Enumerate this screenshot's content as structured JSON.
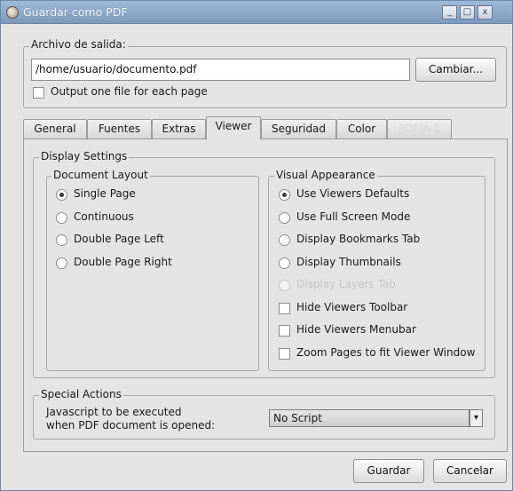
{
  "window": {
    "title": "Guardar como PDF",
    "controls": {
      "minimize": "_",
      "maximize": "□",
      "close": "x"
    }
  },
  "output": {
    "group_label": "Archivo de salida:",
    "path_value": "/home/usuario/documento.pdf",
    "change_button": "Cambiar...",
    "one_file_per_page": {
      "label": "Output one file for each page",
      "checked": false
    }
  },
  "tabs": [
    {
      "label": "General",
      "active": false,
      "disabled": false
    },
    {
      "label": "Fuentes",
      "active": false,
      "disabled": false
    },
    {
      "label": "Extras",
      "active": false,
      "disabled": false
    },
    {
      "label": "Viewer",
      "active": true,
      "disabled": false
    },
    {
      "label": "Seguridad",
      "active": false,
      "disabled": false
    },
    {
      "label": "Color",
      "active": false,
      "disabled": false
    },
    {
      "label": "PDF/A-1",
      "active": false,
      "disabled": true
    }
  ],
  "display_settings": {
    "group_label": "Display Settings",
    "document_layout": {
      "group_label": "Document Layout",
      "options": [
        {
          "label": "Single Page",
          "selected": true
        },
        {
          "label": "Continuous",
          "selected": false
        },
        {
          "label": "Double Page Left",
          "selected": false
        },
        {
          "label": "Double Page Right",
          "selected": false
        }
      ]
    },
    "visual_appearance": {
      "group_label": "Visual Appearance",
      "radios": [
        {
          "label": "Use Viewers Defaults",
          "selected": true,
          "disabled": false
        },
        {
          "label": "Use Full Screen Mode",
          "selected": false,
          "disabled": false
        },
        {
          "label": "Display Bookmarks Tab",
          "selected": false,
          "disabled": false
        },
        {
          "label": "Display Thumbnails",
          "selected": false,
          "disabled": false
        },
        {
          "label": "Display Layers Tab",
          "selected": false,
          "disabled": true
        }
      ],
      "checkboxes": [
        {
          "label": "Hide Viewers Toolbar",
          "checked": false
        },
        {
          "label": "Hide Viewers Menubar",
          "checked": false
        },
        {
          "label": "Zoom Pages to fit Viewer Window",
          "checked": false
        }
      ]
    }
  },
  "special_actions": {
    "group_label": "Special Actions",
    "javascript_label_line1": "Javascript to be executed",
    "javascript_label_line2": "when PDF document is opened:",
    "script_value": "No Script"
  },
  "footer": {
    "save_button": "Guardar",
    "cancel_button": "Cancelar"
  },
  "icons": {
    "app_icon": "app-icon",
    "dropdown_arrow": "▾"
  }
}
